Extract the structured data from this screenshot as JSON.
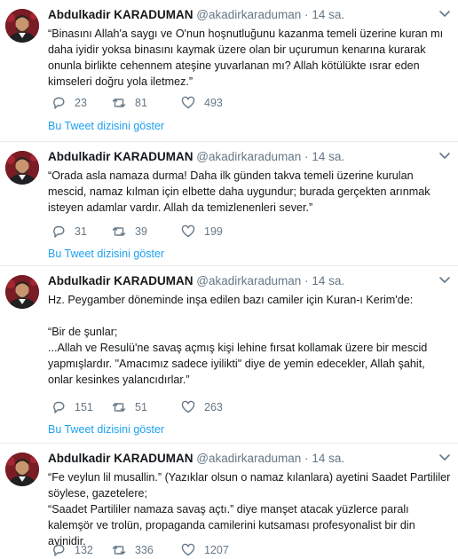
{
  "tweets": [
    {
      "name": "Abdulkadir KARADUMAN",
      "handle": "@akadirkaraduman",
      "dot": "·",
      "time": "14 sa.",
      "text": "“Binasını Allah'a saygı ve O'nun hoşnutluğunu kazanma temeli üzerine kuran mı daha iyidir yoksa binasını kaymak üzere olan bir uçurumun kenarına kurarak onunla birlikte cehennem ateşine yuvarlanan mı? Allah kötülükte ısrar eden kimseleri doğru yola iletmez.”",
      "replies": "23",
      "retweets": "81",
      "likes": "493",
      "thread_link": "Bu Tweet dizisini göster"
    },
    {
      "name": "Abdulkadir KARADUMAN",
      "handle": "@akadirkaraduman",
      "dot": "·",
      "time": "14 sa.",
      "text": "“Orada asla namaza durma! Daha ilk günden takva temeli üzerine kurulan mescid, namaz kılman için elbette daha uygundur; burada gerçekten arınmak isteyen adamlar vardır. Allah da temizlenenleri sever.”",
      "replies": "31",
      "retweets": "39",
      "likes": "199",
      "thread_link": "Bu Tweet dizisini göster"
    },
    {
      "name": "Abdulkadir KARADUMAN",
      "handle": "@akadirkaraduman",
      "dot": "·",
      "time": "14 sa.",
      "text": "Hz. Peygamber döneminde inşa edilen bazı camiler için Kuran-ı Kerim'de:\n\n“Bir de şunlar;\n...Allah ve Resulü'ne savaş açmış kişi lehine fırsat kollamak üzere bir mescid yapmışlardır. \"Amacımız sadece iyilikti\" diye de yemin edecekler, Allah şahit, onlar kesinkes yalancıdırlar.”",
      "replies": "151",
      "retweets": "51",
      "likes": "263",
      "thread_link": "Bu Tweet dizisini göster"
    },
    {
      "name": "Abdulkadir KARADUMAN",
      "handle": "@akadirkaraduman",
      "dot": "·",
      "time": "14 sa.",
      "text": "“Fe veylun lil musallin.” (Yazıklar olsun o namaz kılanlara) ayetini Saadet Partililer söylese, gazetelere;\n“Saadet Partililer namaza savaş açtı.” diye manşet atacak yüzlerce paralı kalemşör ve trolün, propaganda camilerini kutsaması profesyonalist bir din ayinidir.",
      "replies": "132",
      "retweets": "336",
      "likes": "1207",
      "thread_link": ""
    }
  ],
  "icons": {
    "reply": "reply-icon",
    "retweet": "retweet-icon",
    "like": "heart-icon",
    "more": "chevron-down-icon"
  },
  "colors": {
    "link": "#1da1f2",
    "muted": "#657786",
    "divider": "#e6ecf0",
    "avatar_bg": "#7a1c24"
  }
}
